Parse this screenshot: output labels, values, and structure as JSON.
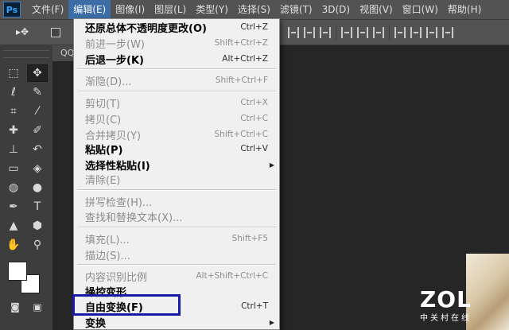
{
  "app": {
    "logo": "Ps"
  },
  "menubar": {
    "items": [
      "文件(F)",
      "编辑(E)",
      "图像(I)",
      "图层(L)",
      "类型(Y)",
      "选择(S)",
      "滤镜(T)",
      "3D(D)",
      "视图(V)",
      "窗口(W)",
      "帮助(H)"
    ],
    "active_index": 1
  },
  "document": {
    "tab_label": "QQ"
  },
  "edit_menu": {
    "items": [
      {
        "label": "还原总体不透明度更改(O)",
        "shortcut": "Ctrl+Z",
        "enabled": true
      },
      {
        "label": "前进一步(W)",
        "shortcut": "Shift+Ctrl+Z",
        "enabled": false
      },
      {
        "label": "后退一步(K)",
        "shortcut": "Alt+Ctrl+Z",
        "enabled": true
      },
      {
        "label": "渐隐(D)...",
        "shortcut": "Shift+Ctrl+F",
        "enabled": false
      },
      {
        "label": "剪切(T)",
        "shortcut": "Ctrl+X",
        "enabled": false
      },
      {
        "label": "拷贝(C)",
        "shortcut": "Ctrl+C",
        "enabled": false
      },
      {
        "label": "合并拷贝(Y)",
        "shortcut": "Shift+Ctrl+C",
        "enabled": false
      },
      {
        "label": "粘贴(P)",
        "shortcut": "Ctrl+V",
        "enabled": true
      },
      {
        "label": "选择性粘贴(I)",
        "shortcut": "",
        "enabled": true,
        "submenu": true
      },
      {
        "label": "清除(E)",
        "shortcut": "",
        "enabled": false
      },
      {
        "label": "拼写检查(H)...",
        "shortcut": "",
        "enabled": false
      },
      {
        "label": "查找和替换文本(X)...",
        "shortcut": "",
        "enabled": false
      },
      {
        "label": "填充(L)...",
        "shortcut": "Shift+F5",
        "enabled": false
      },
      {
        "label": "描边(S)...",
        "shortcut": "",
        "enabled": false
      },
      {
        "label": "内容识别比例",
        "shortcut": "Alt+Shift+Ctrl+C",
        "enabled": false
      },
      {
        "label": "操控变形",
        "shortcut": "",
        "enabled": true
      },
      {
        "label": "自由变换(F)",
        "shortcut": "Ctrl+T",
        "enabled": true,
        "highlighted": true
      },
      {
        "label": "变换",
        "shortcut": "",
        "enabled": true,
        "submenu": true
      }
    ]
  },
  "watermark": {
    "brand": "ZOL",
    "sub": "中关村在线"
  },
  "colors": {
    "menu_bg": "#f0f0f0",
    "highlight_box": "#1a1aa8",
    "active_menu": "#3d6da6",
    "disabled_text": "#8d8d8d"
  },
  "tools": {
    "icons": [
      "marquee-icon",
      "move-icon",
      "lasso-icon",
      "quick-select-icon",
      "crop-icon",
      "eyedropper-icon",
      "healing-brush-icon",
      "brush-icon",
      "clone-stamp-icon",
      "history-brush-icon",
      "eraser-icon",
      "paint-bucket-icon",
      "blur-icon",
      "dodge-icon",
      "pen-icon",
      "type-icon",
      "path-select-icon",
      "shape-icon",
      "hand-icon",
      "zoom-icon"
    ]
  }
}
